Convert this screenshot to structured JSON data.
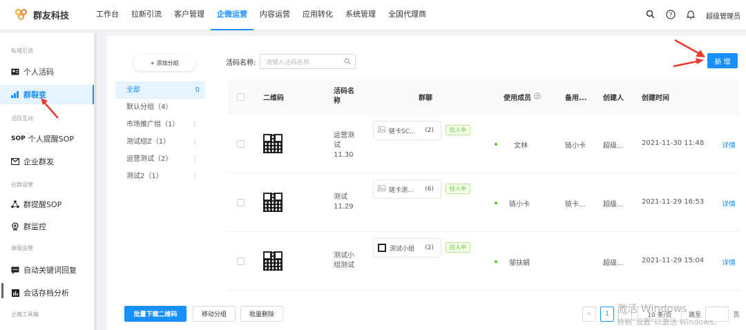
{
  "app": {
    "brand": "群友科技"
  },
  "nav": [
    "工作台",
    "拉新引流",
    "客户管理",
    "企微运营",
    "内容运营",
    "应用转化",
    "系统管理",
    "全国代理商"
  ],
  "nav_active_index": 3,
  "user": {
    "name": "超级管理员"
  },
  "sidebar": {
    "sections": [
      "私域引流",
      "活跃互动",
      "社群运营",
      "商级运营",
      "企微工具箱"
    ],
    "items": [
      {
        "label": "个人活码",
        "icon": "id-card-icon"
      },
      {
        "label": "群裂变",
        "icon": "bar-chart-icon",
        "active": true
      },
      {
        "label": "个人提醒SOP",
        "icon": "sop-icon",
        "icon_text": "SOP"
      },
      {
        "label": "企业群发",
        "icon": "send-mail-icon"
      },
      {
        "label": "群提醒SOP",
        "icon": "share-nodes-icon"
      },
      {
        "label": "群监控",
        "icon": "camera-icon"
      },
      {
        "label": "自动关键词回复",
        "icon": "chat-icon"
      },
      {
        "label": "会话存档分析",
        "icon": "stats-icon"
      }
    ]
  },
  "groups": {
    "add_label": "+ 添加分组",
    "items": [
      {
        "label": "全部",
        "count": "0",
        "active": true
      },
      {
        "label": "默认分组（4）"
      },
      {
        "label": "市场推广组（1）",
        "more": "⋮"
      },
      {
        "label": "测试组Z（1）",
        "more": "⋮"
      },
      {
        "label": "运营测试（2）",
        "more": "⋮"
      },
      {
        "label": "测试2（1）",
        "more": "⋮"
      }
    ]
  },
  "search": {
    "label": "活码名称:",
    "placeholder": "请输入活码名称"
  },
  "new_button": "新 增",
  "table": {
    "headers": {
      "qr": "二维码",
      "name": "活码名称",
      "group": "群聊",
      "member": "使用成员",
      "remark": "备用...",
      "creator": "创建人",
      "time": "创建时间"
    },
    "rows": [
      {
        "name": "运营测试11.30",
        "chip": "链卡SC...",
        "chip_count": "(2)",
        "tag": "拉人中",
        "member": "文林",
        "remark": "链小卡",
        "creator": "超级...",
        "time": "2021-11-30 11:48",
        "action": "详情"
      },
      {
        "name": "测试11.29",
        "chip": "链卡测...",
        "chip_count": "(6)",
        "tag": "拉人中",
        "member": "链小卡",
        "remark": "链卡...",
        "creator": "超级...",
        "time": "2021-11-29 16:53",
        "action": "详情"
      },
      {
        "name": "测试小组测试",
        "chip": "测试小组",
        "chip_count": "(2)",
        "tag": "拉人中",
        "member": "邹扶娟",
        "remark": "",
        "creator": "超级...",
        "time": "2021-11-29 15:04",
        "action": "详情"
      }
    ]
  },
  "footer": {
    "download": "批量下载二维码",
    "move": "移动分组",
    "delete": "批量删除",
    "prev": "<",
    "page": "1",
    "next": ">",
    "page_size": "10 条/页",
    "goto": "跳至",
    "page_unit": "页"
  },
  "watermark": {
    "line1": "激活 Windows",
    "line2": "转到\"设置\"以激活 Windows。"
  },
  "colors": {
    "accent": "#1890ff",
    "success": "#52c41a",
    "arrow": "#e8392a"
  }
}
